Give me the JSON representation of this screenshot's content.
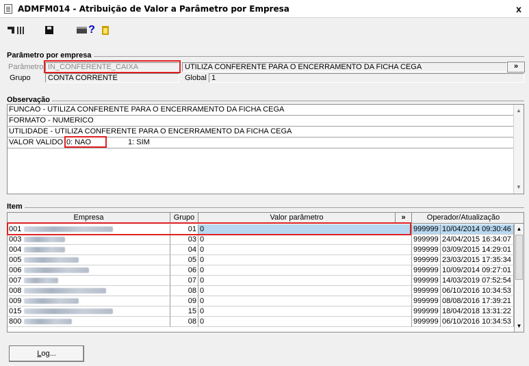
{
  "window": {
    "title": "ADMFM014 - Atribuição de Valor a Parâmetro por Empresa",
    "close_label": "x"
  },
  "toolbar": {
    "help_label": "?"
  },
  "parametro_group": {
    "title": "Parâmetro por empresa",
    "parametro_label": "Parâmetro",
    "parametro_value": "IN_CONFERENTE_CAIXA",
    "parametro_desc": "UTILIZA CONFERENTE PARA O ENCERRAMENTO DA FICHA CEGA",
    "more_label": "»",
    "grupo_label": "Grupo",
    "grupo_value": "CONTA CORRENTE",
    "global_label": "Global",
    "global_value": "1"
  },
  "observacao": {
    "title": "Observação",
    "lines": [
      "FUNCAO - UTILIZA CONFERENTE PARA O ENCERRAMENTO DA FICHA CEGA",
      "FORMATO - NUMERICO",
      "UTILIDADE - UTILIZA CONFERENTE PARA O ENCERRAMENTO DA FICHA CEGA"
    ],
    "valor_valido_label": "VALOR VALIDO",
    "valor_nao": "0: NAO",
    "valor_sim": "1: SIM"
  },
  "item": {
    "title": "Item",
    "columns": {
      "empresa": "Empresa",
      "grupo": "Grupo",
      "valor": "Valor parâmetro",
      "more": "»",
      "operador": "Operador/Atualização"
    },
    "rows": [
      {
        "empresa": "001",
        "grupo": "01",
        "valor": "0",
        "operador": "999999",
        "data": "10/04/2014 09:30:46"
      },
      {
        "empresa": "003",
        "grupo": "03",
        "valor": "0",
        "operador": "999999",
        "data": "24/04/2015 16:34:07"
      },
      {
        "empresa": "004",
        "grupo": "04",
        "valor": "0",
        "operador": "999999",
        "data": "03/09/2015 14:29:01"
      },
      {
        "empresa": "005",
        "grupo": "05",
        "valor": "0",
        "operador": "999999",
        "data": "23/03/2015 17:35:34"
      },
      {
        "empresa": "006",
        "grupo": "06",
        "valor": "0",
        "operador": "999999",
        "data": "10/09/2014 09:27:01"
      },
      {
        "empresa": "007",
        "grupo": "07",
        "valor": "0",
        "operador": "999999",
        "data": "14/03/2019 07:52:54"
      },
      {
        "empresa": "008",
        "grupo": "08",
        "valor": "0",
        "operador": "999999",
        "data": "06/10/2016 10:34:53"
      },
      {
        "empresa": "009",
        "grupo": "09",
        "valor": "0",
        "operador": "999999",
        "data": "08/08/2016 17:39:21"
      },
      {
        "empresa": "015",
        "grupo": "15",
        "valor": "0",
        "operador": "999999",
        "data": "18/04/2018 13:31:22"
      },
      {
        "empresa": "800",
        "grupo": "08",
        "valor": "0",
        "operador": "999999",
        "data": "06/10/2016 10:34:53"
      }
    ]
  },
  "footer": {
    "log_first": "L",
    "log_rest": "og..."
  },
  "colors": {
    "highlight_red": "#e02020",
    "selected_cell": "#b8d8f0"
  }
}
